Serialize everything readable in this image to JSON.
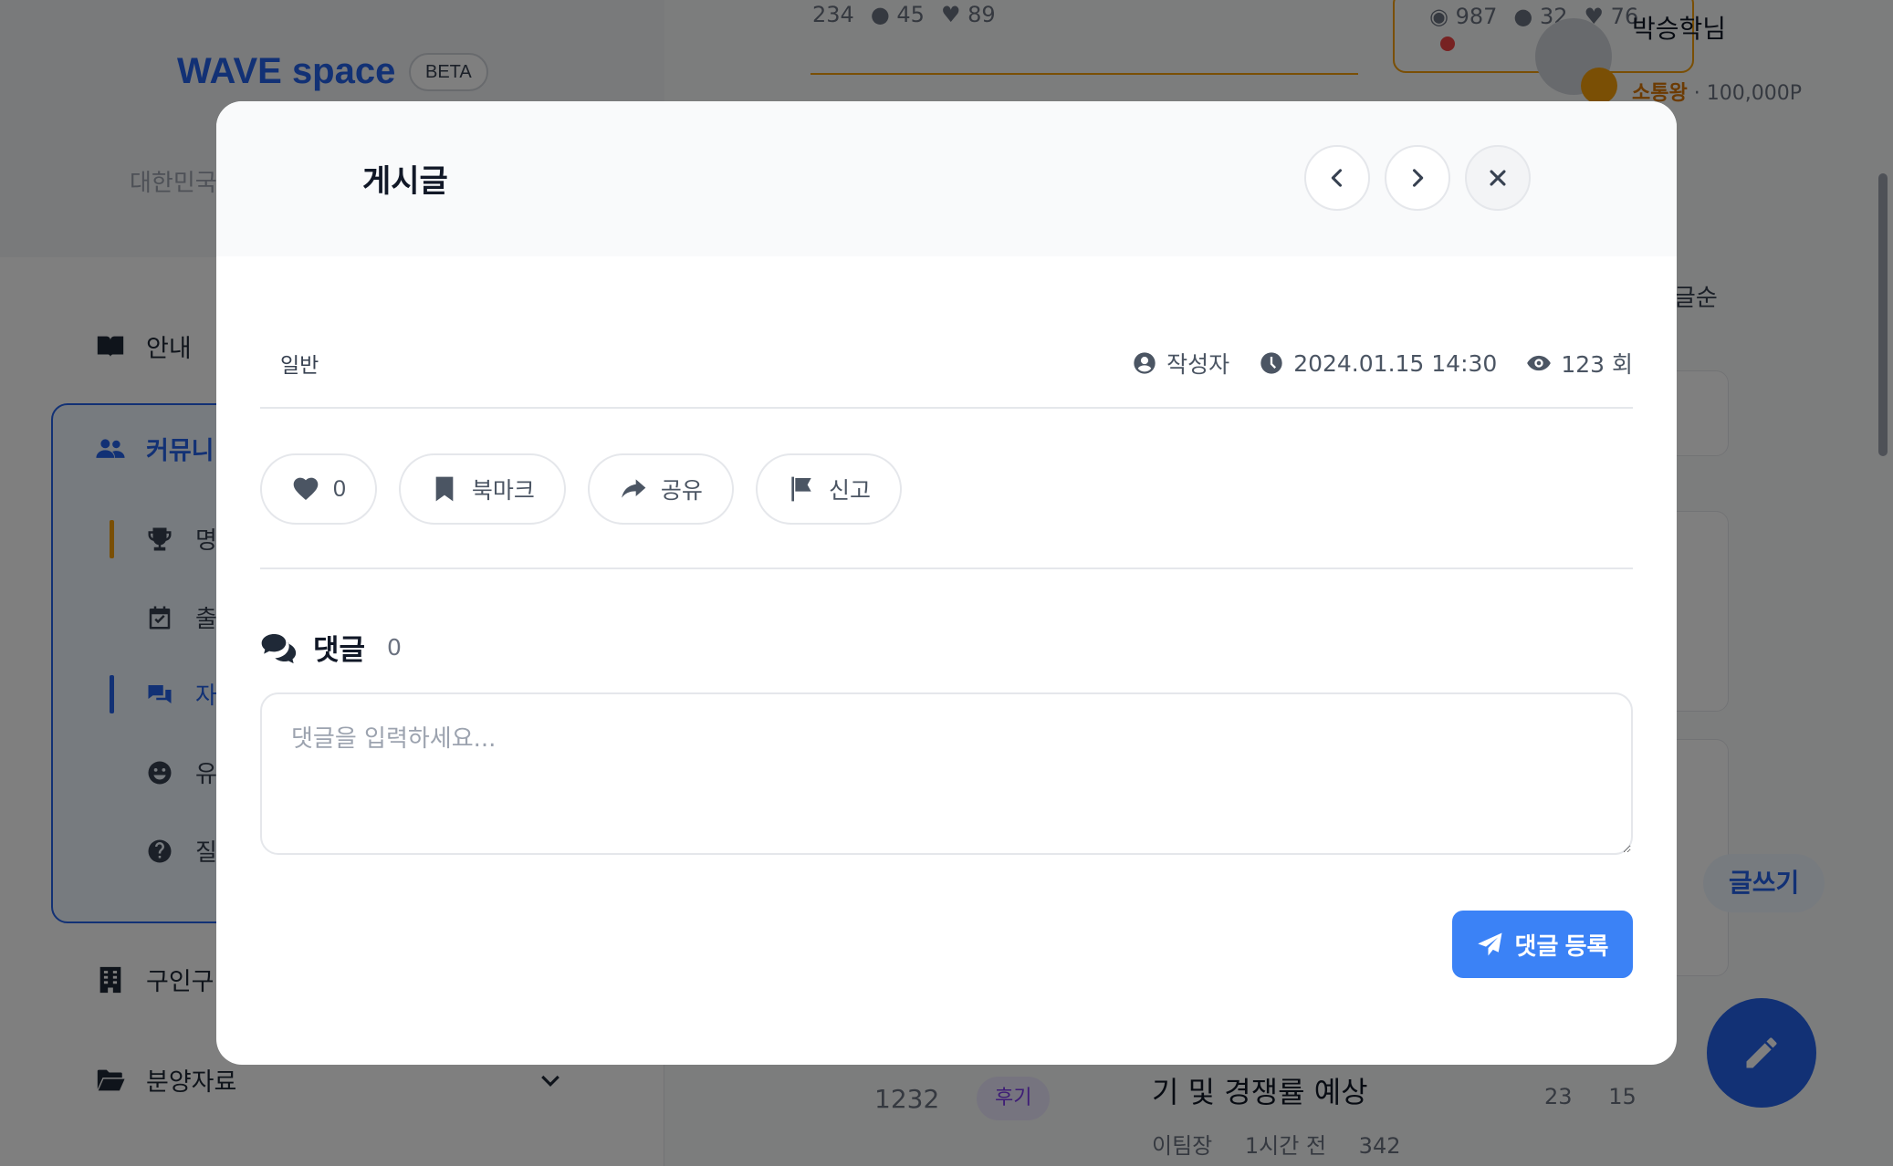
{
  "background": {
    "logo": "WAVE space",
    "beta_badge": "BETA",
    "region": "대한민국",
    "nav": {
      "guide": "안내",
      "community": "커뮤니",
      "jobs": "구인구",
      "sales_data": "분양자료"
    },
    "community_sub": [
      "명",
      "출",
      "자",
      "유",
      "질"
    ],
    "top_stats": {
      "a": "234",
      "comments": "45",
      "likes": "89"
    },
    "top_stats2": {
      "views": "987",
      "comments": "32",
      "likes": "76"
    },
    "user": {
      "name": "박승학님",
      "rank": "소통왕",
      "points": "100,000P"
    },
    "sort_label": "댓글순",
    "write_button": "글쓰기",
    "row": {
      "number": "1232",
      "tag": "후기",
      "title": "기 및 경쟁률 예상",
      "author": "이팀장",
      "time": "1시간 전",
      "views": "342",
      "likes": "23",
      "comments": "15"
    },
    "colors": {
      "accent": "#2563eb",
      "warning": "#f59e0b"
    }
  },
  "modal": {
    "title": "게시글",
    "category": "일반",
    "author": "작성자",
    "datetime": "2024.01.15 14:30",
    "views": "123 회",
    "actions": {
      "likes": "0",
      "bookmark": "북마크",
      "share": "공유",
      "report": "신고"
    },
    "comments": {
      "title": "댓글",
      "count": "0",
      "placeholder": "댓글을 입력하세요...",
      "submit": "댓글 등록"
    },
    "icons": [
      "chevron-left-icon",
      "chevron-right-icon",
      "close-icon",
      "user-circle-icon",
      "clock-icon",
      "eye-icon",
      "heart-icon",
      "bookmark-icon",
      "share-icon",
      "flag-icon",
      "comments-icon",
      "paper-plane-icon"
    ]
  }
}
